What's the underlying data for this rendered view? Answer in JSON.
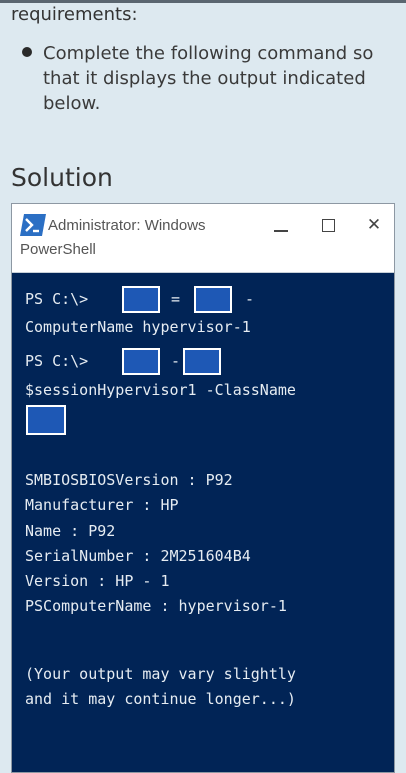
{
  "question": {
    "requirements_label": "requirements:",
    "bullet_text": "Complete the following command so that it displays the output indicated below.",
    "solution_heading": "Solution"
  },
  "window": {
    "title": "Administrator: Windows PowerShell"
  },
  "terminal": {
    "line1_prompt": "PS C:\\>",
    "line1_equals": "=",
    "line1_dash": "-",
    "line2": "ComputerName hypervisor-1",
    "line3_prompt": "PS C:\\>",
    "line3_dash": "-",
    "line4": "$sessionHypervisor1 -ClassName",
    "output": [
      "SMBIOSBIOSVersion : P92",
      "Manufacturer : HP",
      "Name : P92",
      "SerialNumber : 2M251604B4",
      "Version : HP - 1",
      "PSComputerName : hypervisor-1"
    ],
    "note_line1": "(Your output may vary slightly",
    "note_line2": "and it may continue longer...)"
  },
  "colors": {
    "page_bg": "#dde9f0",
    "ps_bg": "#012456",
    "blank_fill": "#1e58b5",
    "terminal_text": "#e6ecf2"
  }
}
